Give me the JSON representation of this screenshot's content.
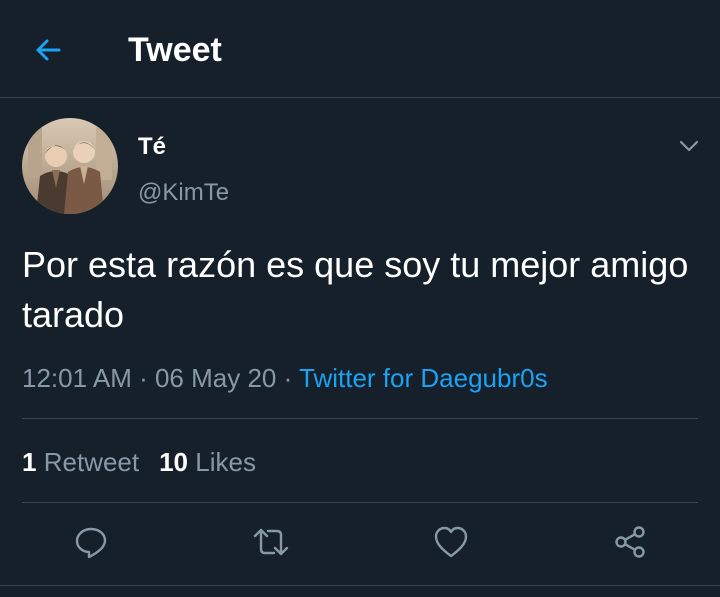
{
  "header": {
    "title": "Tweet",
    "back_icon": "arrow-left-icon"
  },
  "author": {
    "display_name": "Té",
    "handle": "@KimTe",
    "avatar_icon": "avatar-photo"
  },
  "tweet": {
    "text": "Por esta razón es que soy tu mejor amigo tarado",
    "time": "12:01 AM",
    "separator": " · ",
    "date": "06 May 20",
    "source": "Twitter for Daegubr0s"
  },
  "stats": {
    "retweets_count": "1",
    "retweets_label": "Retweet",
    "likes_count": "10",
    "likes_label": "Likes"
  },
  "actions": [
    "reply-icon",
    "retweet-icon",
    "like-icon",
    "share-icon"
  ],
  "colors": {
    "background": "#15202b",
    "accent": "#1da1f2",
    "secondary_text": "#8899a6",
    "divider": "#38444d"
  }
}
